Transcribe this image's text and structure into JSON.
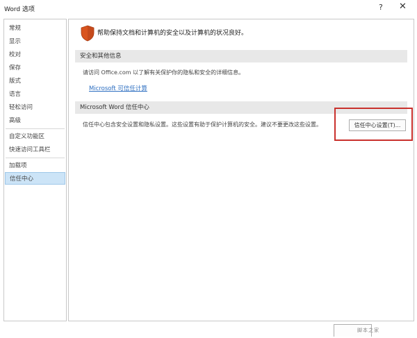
{
  "window": {
    "title": "Word 选项",
    "help_label": "?",
    "close_label": "✕"
  },
  "sidebar": {
    "items": [
      {
        "label": "常规"
      },
      {
        "label": "显示"
      },
      {
        "label": "校对"
      },
      {
        "label": "保存"
      },
      {
        "label": "版式"
      },
      {
        "label": "语言"
      },
      {
        "label": "轻松访问"
      },
      {
        "label": "高级"
      },
      {
        "label": "自定义功能区"
      },
      {
        "label": "快速访问工具栏"
      },
      {
        "label": "加载项"
      },
      {
        "label": "信任中心",
        "selected": true
      }
    ]
  },
  "main": {
    "headline_icon": "shield-icon",
    "headline": "帮助保持文档和计算机的安全以及计算机的状况良好。",
    "security_section": {
      "title": "安全和其他信息",
      "text": "请访问 Office.com 以了解有关保护你的隐私和安全的详细信息。",
      "link": "Microsoft 可信任计算"
    },
    "trust_section": {
      "title": "Microsoft Word 信任中心",
      "text": "信任中心包含安全设置和隐私设置。这些设置有助于保护计算机的安全。建议不要更改这些设置。",
      "button": "信任中心设置(T)..."
    }
  },
  "footer": {
    "watermark": "脚本之家"
  },
  "colors": {
    "selected_bg": "#cce4f7",
    "link": "#2a6cc0",
    "highlight_border": "#c9302c",
    "shield": "#d9541e"
  }
}
